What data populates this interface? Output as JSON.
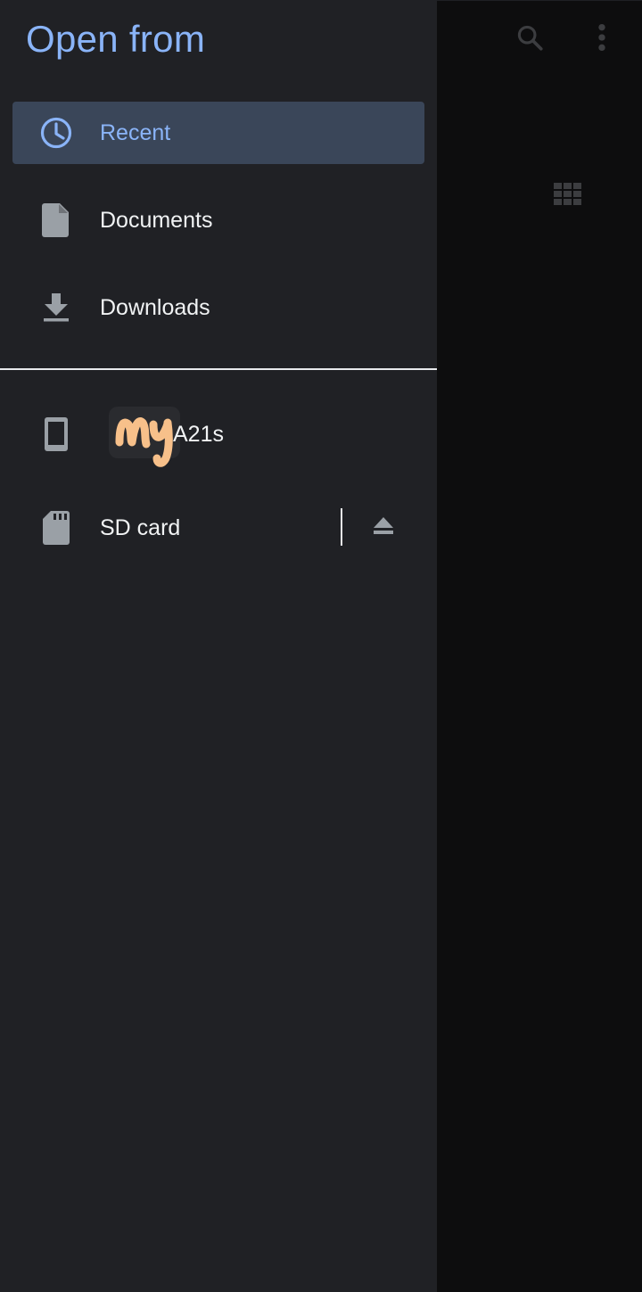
{
  "drawer": {
    "title": "Open from",
    "items": [
      {
        "label": "Recent",
        "icon": "clock-icon",
        "selected": true
      },
      {
        "label": "Documents",
        "icon": "document-icon",
        "selected": false
      },
      {
        "label": "Downloads",
        "icon": "download-icon",
        "selected": false
      }
    ],
    "storage": [
      {
        "label": "A21s",
        "icon": "phone-icon",
        "redaction_text": "my"
      },
      {
        "label": "SD card",
        "icon": "sd-card-icon",
        "action_icon": "eject-icon"
      }
    ]
  },
  "toolbar": {
    "icons": [
      "search-icon",
      "more-vert-icon",
      "grid-view-icon"
    ]
  },
  "colors": {
    "accent": "#8ab4f8",
    "drawer_bg": "#202125",
    "selected_bg": "#3a4659",
    "main_bg": "#0d0d0e",
    "text": "#f1f3f4",
    "icon": "#9aa0a6",
    "scribble": "#f7c08a"
  }
}
